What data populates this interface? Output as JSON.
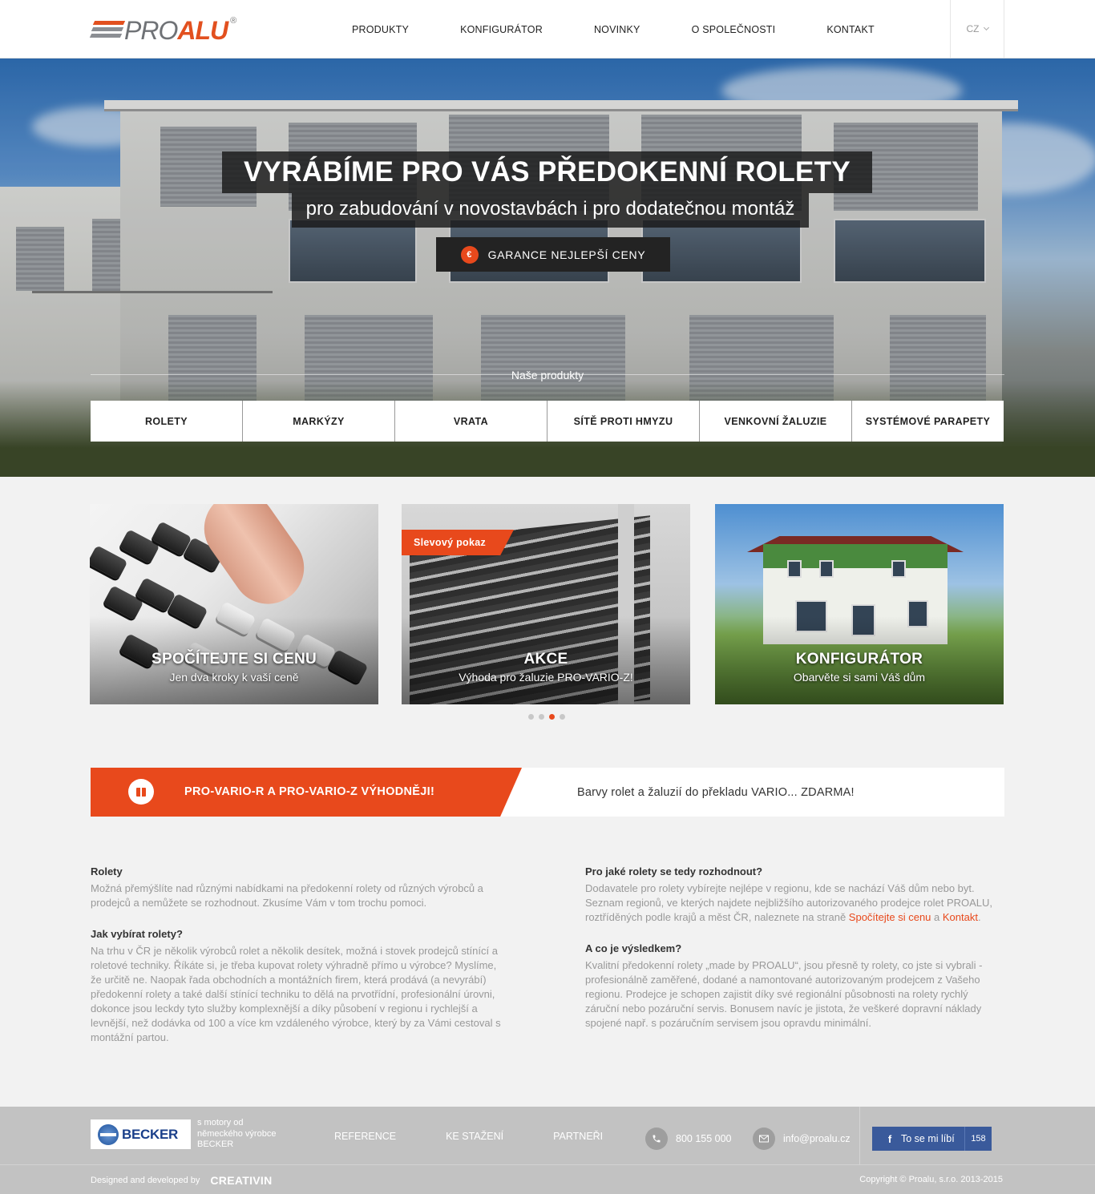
{
  "header": {
    "logo_pro": "PRO",
    "logo_alu": "ALU",
    "logo_reg": "®",
    "nav": [
      "PRODUKTY",
      "KONFIGURÁTOR",
      "NOVINKY",
      "O SPOLEČNOSTI",
      "KONTAKT"
    ],
    "lang": "CZ"
  },
  "hero": {
    "title": "VYRÁBÍME PRO VÁS PŘEDOKENNÍ ROLETY",
    "subtitle": "pro zabudování v novostavbách i pro dodatečnou montáž",
    "button_icon": "€",
    "button_label": "GARANCE NEJLEPŠÍ CENY",
    "products_label": "Naše produkty",
    "products": [
      "ROLETY",
      "MARKÝZY",
      "VRATA",
      "SÍTĚ PROTI HMYZU",
      "VENKOVNÍ ŽALUZIE",
      "SYSTÉMOVÉ PARAPETY"
    ]
  },
  "cards": [
    {
      "title": "SPOČÍTEJTE SI CENU",
      "subtitle": "Jen dva kroky k vaší ceně"
    },
    {
      "badge": "Slevový pokaz",
      "title": "AKCE",
      "subtitle": "Výhoda pro žaluzie PRO-VARIO-Z!"
    },
    {
      "title": "KONFIGURÁTOR",
      "subtitle": "Obarvěte si sami Váš dům"
    }
  ],
  "carousel": {
    "count": 4,
    "active": 3
  },
  "promo": {
    "title": "PRO-VARIO-R A PRO-VARIO-Z VÝHODNĚJI!",
    "text": "Barvy rolet a žaluzií do překladu VARIO... ZDARMA!"
  },
  "articles": {
    "left": [
      {
        "heading": "Rolety",
        "body": "Možná přemýšlíte nad různými nabídkami na předokenní rolety od různých výrobců a prodejců a nemůžete se rozhodnout. Zkusíme Vám v tom trochu pomoci."
      },
      {
        "heading": "Jak vybírat rolety?",
        "body": "Na trhu v ČR je několik výrobců rolet a několik desítek, možná i stovek prodejců stínící a roletové techniky. Říkáte si, je třeba kupovat rolety výhradně přímo u výrobce? Myslíme, že určitě ne. Naopak řada obchodních a montážních firem, která prodává (a nevyrábí) předokenní rolety a také další stínící techniku to dělá na prvotřídní, profesionální úrovni, dokonce jsou leckdy tyto služby komplexnější a díky působení v regionu i rychlejší a levnější, než dodávka od 100 a více km vzdáleného výrobce, který by za Vámi cestoval s montážní partou."
      }
    ],
    "right": [
      {
        "heading": "Pro jaké rolety se tedy rozhodnout?",
        "body_start": "Dodavatele pro rolety vybírejte nejlépe v regionu, kde se nachází Váš dům nebo byt. Seznam regionů, ve kterých najdete nejbližšího autorizovaného prodejce rolet PROALU, roztříděných podle krajů a měst ČR, naleznete na straně ",
        "link1": "Spočítejte si cenu",
        "mid": " a ",
        "link2": "Kontakt",
        "end": "."
      },
      {
        "heading": "A co je výsledkem?",
        "body": "Kvalitní předokenní rolety „made by PROALU“, jsou přesně ty rolety, co jste si vybrali - profesionálně zaměřené, dodané a namontované autorizovaným prodejcem z Vašeho regionu. Prodejce je schopen zajistit díky své regionální působnosti na rolety rychlý záruční nebo pozáruční servis. Bonusem navíc je jistota, že veškeré dopravní náklady spojené např. s pozáručním servisem jsou opravdu minimální."
      }
    ]
  },
  "footer": {
    "becker_logo": "BECKER",
    "becker_note": "s motory od německého výrobce BECKER",
    "links": [
      "REFERENCE",
      "KE STAŽENÍ",
      "PARTNEŘI"
    ],
    "phone": "800 155 000",
    "email": "info@proalu.cz",
    "fb_f": "f",
    "fb_label": "To se mi líbí",
    "fb_count": "158",
    "designed_by": "Designed and developed by",
    "designer": "CREATIVIN",
    "copyright": "Copyright © Proalu, s.r.o. 2013-2015"
  },
  "colors": {
    "accent": "#e8491c",
    "footer_bg": "#c2c2c2",
    "fb": "#3a5a9b"
  }
}
